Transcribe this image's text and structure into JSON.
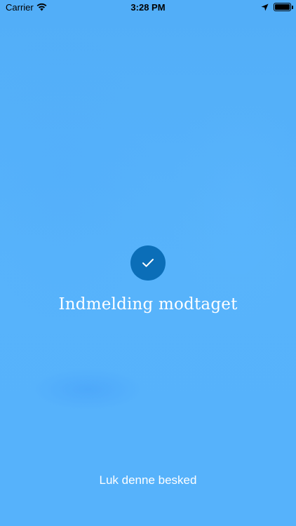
{
  "status_bar": {
    "carrier": "Carrier",
    "time": "3:28 PM",
    "icons": [
      "wifi-icon",
      "location-arrow-icon",
      "battery-icon"
    ]
  },
  "confirmation": {
    "icon": "checkmark-icon",
    "title": "Indmelding modtaget",
    "dismiss_label": "Luk denne besked"
  },
  "colors": {
    "background": "#55b2fb",
    "check_circle": "#0b6eb8",
    "text": "#ffffff"
  }
}
